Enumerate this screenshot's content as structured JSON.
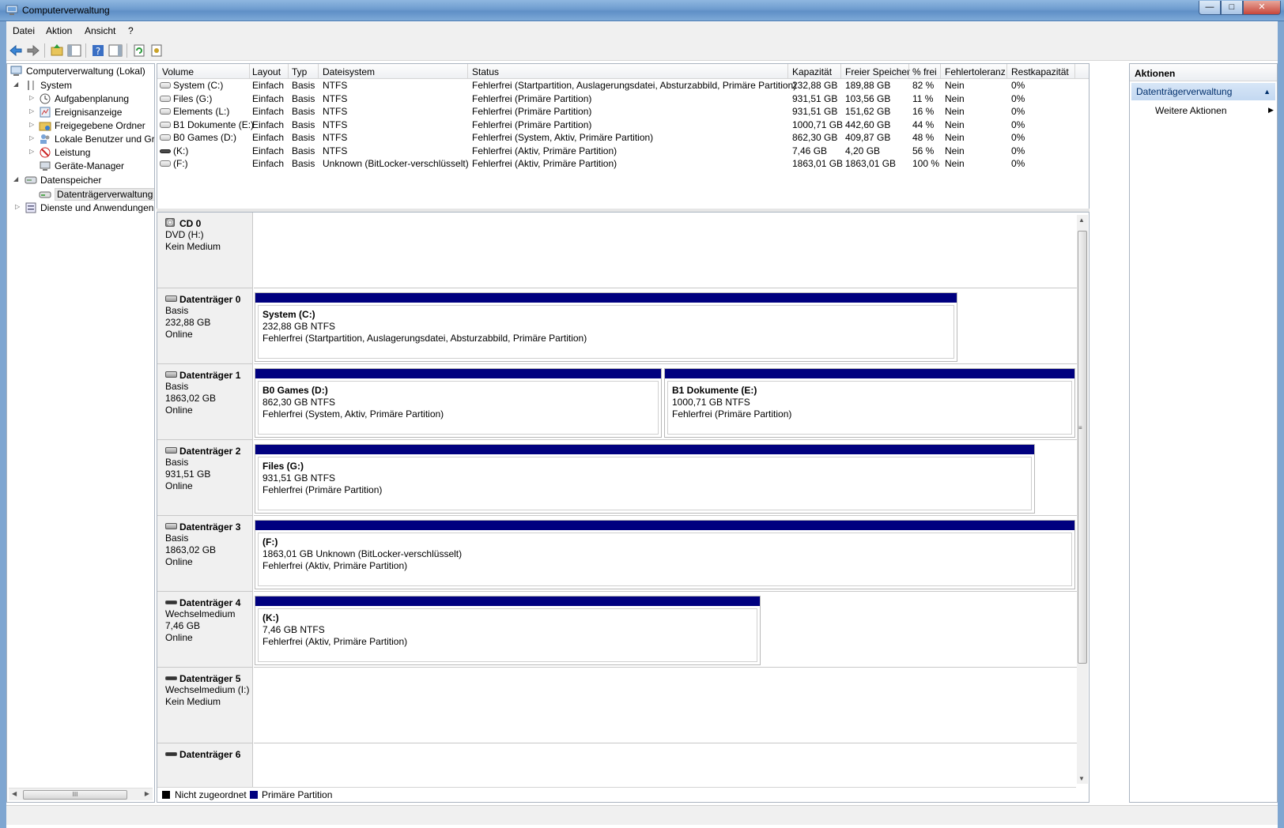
{
  "window": {
    "title": "Computerverwaltung"
  },
  "menu": [
    "Datei",
    "Aktion",
    "Ansicht",
    "?"
  ],
  "tree": {
    "root": "Computerverwaltung (Lokal)",
    "system": "System",
    "system_children": [
      "Aufgabenplanung",
      "Ereignisanzeige",
      "Freigegebene Ordner",
      "Lokale Benutzer und Gru",
      "Leistung",
      "Geräte-Manager"
    ],
    "storage": "Datenspeicher",
    "storage_children": [
      "Datenträgerverwaltung"
    ],
    "services": "Dienste und Anwendungen",
    "scroll_glyph": "III"
  },
  "table": {
    "headers": [
      "Volume",
      "Layout",
      "Typ",
      "Dateisystem",
      "Status",
      "Kapazität",
      "Freier Speicher",
      "% frei",
      "Fehlertoleranz",
      "Restkapazität"
    ],
    "rows": [
      [
        "System (C:)",
        "Einfach",
        "Basis",
        "NTFS",
        "Fehlerfrei (Startpartition, Auslagerungsdatei, Absturzabbild, Primäre Partition)",
        "232,88 GB",
        "189,88 GB",
        "82 %",
        "Nein",
        "0%"
      ],
      [
        "Files (G:)",
        "Einfach",
        "Basis",
        "NTFS",
        "Fehlerfrei (Primäre Partition)",
        "931,51 GB",
        "103,56 GB",
        "11 %",
        "Nein",
        "0%"
      ],
      [
        "Elements (L:)",
        "Einfach",
        "Basis",
        "NTFS",
        "Fehlerfrei (Primäre Partition)",
        "931,51 GB",
        "151,62 GB",
        "16 %",
        "Nein",
        "0%"
      ],
      [
        "B1 Dokumente (E:)",
        "Einfach",
        "Basis",
        "NTFS",
        "Fehlerfrei (Primäre Partition)",
        "1000,71 GB",
        "442,60 GB",
        "44 %",
        "Nein",
        "0%"
      ],
      [
        "B0 Games (D:)",
        "Einfach",
        "Basis",
        "NTFS",
        "Fehlerfrei (System, Aktiv, Primäre Partition)",
        "862,30 GB",
        "409,87 GB",
        "48 %",
        "Nein",
        "0%"
      ],
      [
        "(K:)",
        "Einfach",
        "Basis",
        "NTFS",
        "Fehlerfrei (Aktiv, Primäre Partition)",
        "7,46 GB",
        "4,20 GB",
        "56 %",
        "Nein",
        "0%"
      ],
      [
        "(F:)",
        "Einfach",
        "Basis",
        "Unknown (BitLocker-verschlüsselt)",
        "Fehlerfrei (Aktiv, Primäre Partition)",
        "1863,01 GB",
        "1863,01 GB",
        "100 %",
        "Nein",
        "0%"
      ]
    ]
  },
  "disks": [
    {
      "name": "CD 0",
      "line1": "DVD (H:)",
      "line2": "",
      "line3": "Kein Medium",
      "partitions": []
    },
    {
      "name": "Datenträger 0",
      "line1": "Basis",
      "line2": "232,88 GB",
      "line3": "Online",
      "partitions": [
        {
          "name": "System  (C:)",
          "size": "232,88 GB NTFS",
          "status": "Fehlerfrei (Startpartition, Auslagerungsdatei, Absturzabbild, Primäre Partition)"
        }
      ]
    },
    {
      "name": "Datenträger 1",
      "line1": "Basis",
      "line2": "1863,02 GB",
      "line3": "Online",
      "partitions": [
        {
          "name": "B0 Games  (D:)",
          "size": "862,30 GB NTFS",
          "status": "Fehlerfrei (System, Aktiv, Primäre Partition)"
        },
        {
          "name": "B1 Dokumente  (E:)",
          "size": "1000,71 GB NTFS",
          "status": "Fehlerfrei (Primäre Partition)"
        }
      ]
    },
    {
      "name": "Datenträger 2",
      "line1": "Basis",
      "line2": "931,51 GB",
      "line3": "Online",
      "partitions": [
        {
          "name": "Files  (G:)",
          "size": "931,51 GB NTFS",
          "status": "Fehlerfrei (Primäre Partition)"
        }
      ]
    },
    {
      "name": "Datenträger 3",
      "line1": "Basis",
      "line2": "1863,02 GB",
      "line3": "Online",
      "partitions": [
        {
          "name": "(F:)",
          "size": "1863,01 GB Unknown (BitLocker-verschlüsselt)",
          "status": "Fehlerfrei (Aktiv, Primäre Partition)"
        }
      ]
    },
    {
      "name": "Datenträger 4",
      "line1": "Wechselmedium",
      "line2": "7,46 GB",
      "line3": "Online",
      "partitions": [
        {
          "name": "(K:)",
          "size": "7,46 GB NTFS",
          "status": "Fehlerfrei (Aktiv, Primäre Partition)"
        }
      ]
    },
    {
      "name": "Datenträger 5",
      "line1": "Wechselmedium (I:)",
      "line2": "",
      "line3": "Kein Medium",
      "partitions": []
    },
    {
      "name": "Datenträger 6",
      "line1": "",
      "line2": "",
      "line3": "",
      "partitions": []
    }
  ],
  "legend": [
    {
      "label": "Nicht zugeordnet",
      "color": "#000000"
    },
    {
      "label": "Primäre Partition",
      "color": "#00007f"
    }
  ],
  "actions": {
    "header": "Aktionen",
    "group": "Datenträgerverwaltung",
    "item": "Weitere Aktionen"
  },
  "colors": {
    "partition_bar": "#00007f",
    "selection": "#e6e6e6"
  }
}
